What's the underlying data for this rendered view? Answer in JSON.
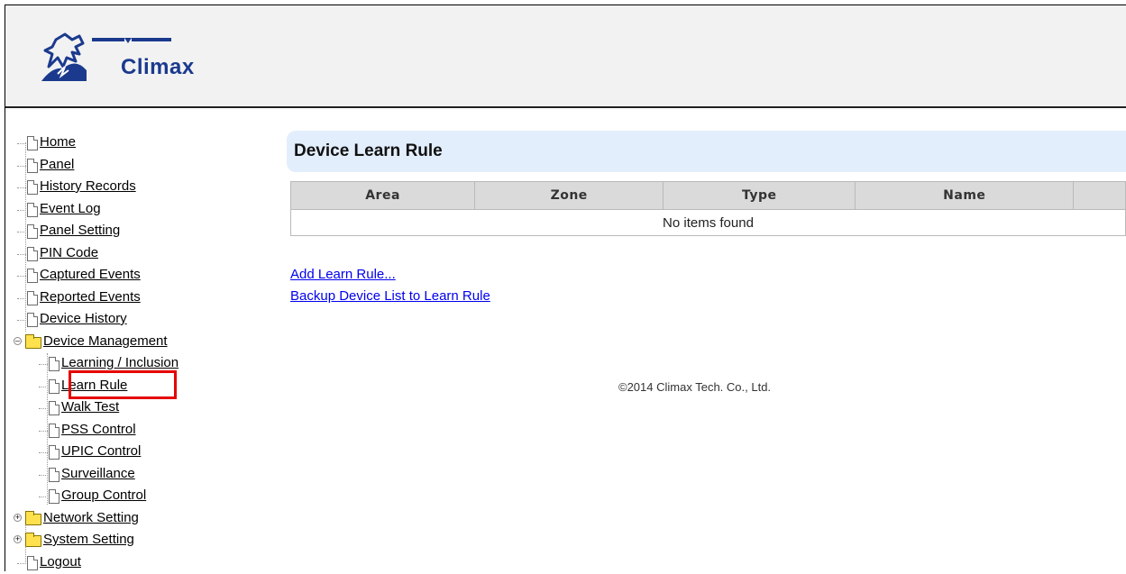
{
  "brand": {
    "name": "Climax"
  },
  "nav": [
    {
      "id": "home",
      "label": "Home",
      "icon": "doc-icon"
    },
    {
      "id": "panel",
      "label": "Panel",
      "icon": "doc-icon"
    },
    {
      "id": "history",
      "label": "History Records",
      "icon": "doc-icon"
    },
    {
      "id": "eventlog",
      "label": "Event Log",
      "icon": "doc-icon"
    },
    {
      "id": "panelsetting",
      "label": "Panel Setting",
      "icon": "doc-icon"
    },
    {
      "id": "pincode",
      "label": "PIN Code",
      "icon": "doc-icon"
    },
    {
      "id": "captured",
      "label": "Captured Events",
      "icon": "doc-icon"
    },
    {
      "id": "reported",
      "label": "Reported Events",
      "icon": "doc-icon"
    },
    {
      "id": "devhistory",
      "label": "Device History",
      "icon": "doc-icon"
    },
    {
      "id": "devmgmt",
      "label": "Device Management",
      "icon": "folder-open-icon",
      "expanded": true,
      "children": [
        {
          "id": "learning",
          "label": "Learning / Inclusion",
          "icon": "doc-icon"
        },
        {
          "id": "learnrule",
          "label": "Learn Rule",
          "icon": "doc-icon",
          "selected": true
        },
        {
          "id": "walktest",
          "label": "Walk Test",
          "icon": "doc-icon"
        },
        {
          "id": "pss",
          "label": "PSS Control",
          "icon": "doc-icon"
        },
        {
          "id": "upic",
          "label": "UPIC Control",
          "icon": "doc-icon"
        },
        {
          "id": "surv",
          "label": "Surveillance",
          "icon": "doc-icon"
        },
        {
          "id": "group",
          "label": "Group Control",
          "icon": "doc-icon"
        }
      ]
    },
    {
      "id": "network",
      "label": "Network Setting",
      "icon": "folder-icon",
      "expanded": false
    },
    {
      "id": "system",
      "label": "System Setting",
      "icon": "folder-icon",
      "expanded": false
    },
    {
      "id": "logout",
      "label": "Logout",
      "icon": "doc-icon"
    }
  ],
  "main": {
    "title": "Device Learn Rule",
    "table": {
      "headers": [
        "Area",
        "Zone",
        "Type",
        "Name",
        ""
      ],
      "empty_message": "No items found"
    },
    "links": {
      "add": "Add Learn Rule...",
      "backup": "Backup Device List to Learn Rule"
    },
    "footer": "©2014 Climax Tech. Co., Ltd."
  },
  "colors": {
    "title_bar": "#e3eefc",
    "highlight": "#e60000",
    "link": "#0000ee",
    "brand": "#1b3a8e"
  }
}
